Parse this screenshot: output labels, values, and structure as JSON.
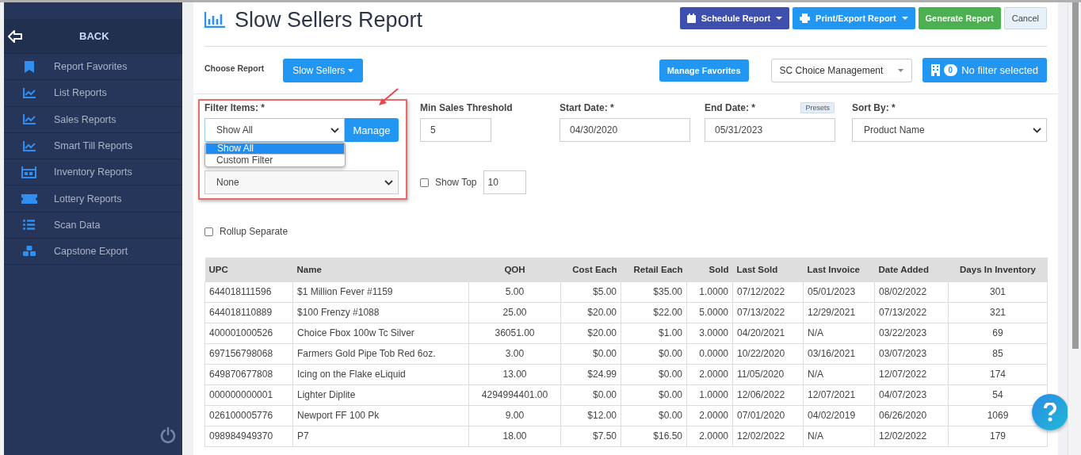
{
  "sidebar": {
    "back_label": "BACK",
    "items": [
      {
        "label": "Report Favorites"
      },
      {
        "label": "List Reports"
      },
      {
        "label": "Sales Reports"
      },
      {
        "label": "Smart Till Reports"
      },
      {
        "label": "Inventory Reports"
      },
      {
        "label": "Lottery Reports"
      },
      {
        "label": "Scan Data"
      },
      {
        "label": "Capstone Export"
      }
    ]
  },
  "header": {
    "title": "Slow Sellers Report",
    "buttons": [
      {
        "kind": "schedule",
        "label": "Schedule Report"
      },
      {
        "kind": "export",
        "label": "Print/Export Report"
      },
      {
        "kind": "generate",
        "label": "Generate Report"
      },
      {
        "kind": "cancel",
        "label": "Cancel"
      }
    ]
  },
  "toolbar": {
    "choose_label": "Choose Report",
    "report_button": "Slow Sellers",
    "manage_favorites": "Manage Favorites",
    "location": "SC Choice Management",
    "filter_count": "0",
    "filter_label": "No filter selected"
  },
  "filters": {
    "filter_items": {
      "label": "Filter Items: *",
      "value": "Show All",
      "button": "Manage",
      "options": [
        {
          "label": "Show All",
          "selected": true
        },
        {
          "label": "Custom Filter",
          "selected": false
        }
      ]
    },
    "min_sales": {
      "label": "Min Sales Threshold",
      "value": "5"
    },
    "start_date": {
      "label": "Start Date: *",
      "value": "04/30/2020"
    },
    "end_date": {
      "label": "End Date: *",
      "value": "05/31/2023",
      "presets": "Presets"
    },
    "sort_by": {
      "label": "Sort By: *",
      "value": "Product Name"
    },
    "second_select": {
      "value": "None"
    },
    "show_top": {
      "label": "Show Top",
      "checked": false,
      "value": "10"
    },
    "rollup": {
      "label": "Rollup Separate",
      "checked": false
    }
  },
  "table": {
    "columns": [
      "UPC",
      "Name",
      "QOH",
      "Cost Each",
      "Retail Each",
      "Sold",
      "Last Sold",
      "Last Invoice",
      "Date Added",
      "Days In Inventory"
    ],
    "rows": [
      [
        "644018111596",
        "$1 Million Fever #1159",
        "5.00",
        "$5.00",
        "$35.00",
        "1.0000",
        "07/12/2022",
        "05/01/2023",
        "08/02/2022",
        "301"
      ],
      [
        "644018110889",
        "$100 Frenzy #1088",
        "25.00",
        "$20.00",
        "$22.00",
        "5.0000",
        "07/13/2022",
        "12/29/2021",
        "07/13/2022",
        "321"
      ],
      [
        "400001000526",
        "Choice Fbox 100w Tc Silver",
        "36051.00",
        "$20.00",
        "$1.00",
        "3.0000",
        "04/20/2021",
        "N/A",
        "03/22/2023",
        "69"
      ],
      [
        "697156798068",
        "Farmers Gold Pipe Tob Red 6oz.",
        "3.00",
        "$0.00",
        "$0.00",
        "0.0000",
        "10/22/2020",
        "03/16/2021",
        "03/07/2023",
        "85"
      ],
      [
        "649870677808",
        "Icing on the Flake eLiquid",
        "13.00",
        "$24.99",
        "$0.00",
        "2.0000",
        "11/05/2020",
        "N/A",
        "12/07/2022",
        "174"
      ],
      [
        "000000000001",
        "Lighter Diplite",
        "4294994401.00",
        "$0.00",
        "$0.00",
        "1.0000",
        "12/06/2022",
        "12/07/2021",
        "04/07/2023",
        "54"
      ],
      [
        "026100005776",
        "Newport FF 100 Pk",
        "9.00",
        "$12.00",
        "$0.00",
        "2.0000",
        "07/01/2020",
        "04/02/2019",
        "06/26/2020",
        "1069"
      ],
      [
        "098984949370",
        "P7",
        "18.00",
        "$7.50",
        "$16.50",
        "2.0000",
        "12/02/2022",
        "N/A",
        "12/02/2022",
        "179"
      ]
    ]
  }
}
